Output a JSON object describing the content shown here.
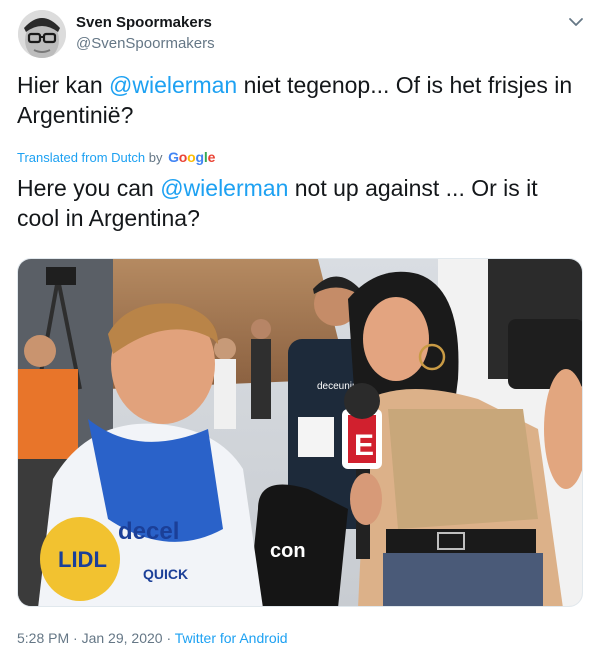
{
  "author": {
    "name": "Sven Spoormakers",
    "handle": "@SvenSpoormakers",
    "avatar_icon": "profile-photo-avatar"
  },
  "menu_icon": "chevron-down-icon",
  "tweet": {
    "original": {
      "part1": "Hier kan ",
      "mention": "@wielerman",
      "part2": " niet tegenop... Of is het frisjes in Argentinië?"
    },
    "translation_notice": {
      "prefix": "Translated from Dutch",
      "by": " by ",
      "provider": "Google"
    },
    "translated": {
      "part1": "Here you can ",
      "mention": "@wielerman",
      "part2": " not up against ... Or is it cool in Argentina?"
    }
  },
  "media": {
    "signs": {
      "jersey_brand": "decel",
      "jersey_sponsor": "QUICK",
      "jersey_logo": "LIDL",
      "mic_logo": "E",
      "bag_text": "con",
      "staff_shirt": "deceuninck"
    }
  },
  "footer": {
    "time": "5:28 PM",
    "separator": " · ",
    "date": "Jan 29, 2020",
    "source": "Twitter for Android"
  },
  "colors": {
    "link": "#1da1f2",
    "text": "#14171a",
    "secondary": "#657786"
  }
}
